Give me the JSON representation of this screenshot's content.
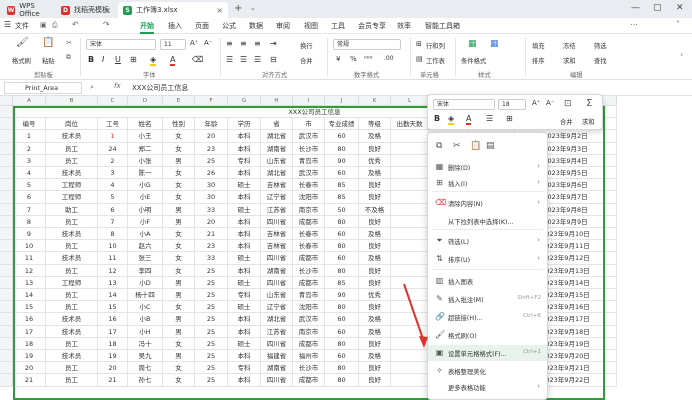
{
  "titlebar": {
    "tabs": [
      {
        "label": "WPS Office",
        "icon": "wps-logo-icon",
        "color": "#e0322b"
      },
      {
        "label": "找稻壳模板",
        "icon": "docer-icon",
        "color": "#e0322b"
      },
      {
        "label": "工作簿3.xlsx",
        "icon": "spreadsheet-icon",
        "color": "#1f9e55"
      }
    ],
    "new_tab": "+"
  },
  "menubar": {
    "items": [
      "文件",
      "开始",
      "插入",
      "页面",
      "公式",
      "数据",
      "审阅",
      "视图",
      "工具",
      "会员专享",
      "效率",
      "智能工具箱"
    ],
    "active": "开始"
  },
  "ribbon": {
    "format_painter": "格式刷",
    "paste": "粘贴",
    "font_name": "宋体",
    "font_size": "11",
    "number_format": "常规",
    "wrap_text": "换行",
    "merge": "合并",
    "row_col": "行和列",
    "worksheet": "工作表",
    "conditional_format": "条件格式",
    "fill": "填充",
    "sort": "排序",
    "freeze": "冻结",
    "sum": "求和",
    "filter": "筛选",
    "find": "查找",
    "groups": [
      "剪贴板",
      "字体",
      "对齐方式",
      "数字格式",
      "单元格",
      "样式",
      "编辑"
    ]
  },
  "formulabar": {
    "name_box": "Print_Area",
    "fx": "fx",
    "content": "XXX公司员工信息"
  },
  "sheet": {
    "columns": [
      "A",
      "B",
      "C",
      "D",
      "E",
      "F",
      "G",
      "H",
      "I",
      "J",
      "K",
      "L",
      "M",
      "N",
      "O"
    ],
    "title": "XXX公司员工信息",
    "headers": [
      "编号",
      "岗位",
      "工号",
      "姓名",
      "性别",
      "年龄",
      "学历",
      "省",
      "市",
      "专业成绩",
      "等级",
      "出勤天数"
    ],
    "rows": [
      [
        "1",
        "技术员",
        "1",
        "小王",
        "女",
        "20",
        "本科",
        "湖北省",
        "武汉市",
        "60",
        "及格"
      ],
      [
        "2",
        "员工",
        "24",
        "郑二",
        "女",
        "23",
        "本科",
        "湖南省",
        "长沙市",
        "80",
        "良好"
      ],
      [
        "3",
        "员工",
        "2",
        "小张",
        "男",
        "25",
        "专科",
        "山东省",
        "青岛市",
        "90",
        "优秀"
      ],
      [
        "4",
        "技术员",
        "3",
        "陈一",
        "女",
        "26",
        "本科",
        "湖北省",
        "武汉市",
        "60",
        "及格"
      ],
      [
        "5",
        "工程师",
        "4",
        "小G",
        "女",
        "30",
        "硕士",
        "吉林省",
        "长春市",
        "85",
        "良好"
      ],
      [
        "6",
        "工程师",
        "5",
        "小E",
        "女",
        "30",
        "本科",
        "辽宁省",
        "沈阳市",
        "85",
        "良好"
      ],
      [
        "7",
        "助工",
        "6",
        "小明",
        "男",
        "33",
        "硕士",
        "江苏省",
        "南京市",
        "50",
        "不及格"
      ],
      [
        "8",
        "员工",
        "7",
        "小F",
        "男",
        "20",
        "本科",
        "四川省",
        "成都市",
        "80",
        "良好"
      ],
      [
        "9",
        "技术员",
        "8",
        "小A",
        "女",
        "21",
        "本科",
        "吉林省",
        "长春市",
        "60",
        "及格"
      ],
      [
        "10",
        "员工",
        "10",
        "赵六",
        "女",
        "23",
        "本科",
        "吉林省",
        "长春市",
        "80",
        "良好"
      ],
      [
        "11",
        "技术员",
        "11",
        "张三",
        "女",
        "33",
        "硕士",
        "四川省",
        "成都市",
        "60",
        "及格"
      ],
      [
        "12",
        "员工",
        "12",
        "李四",
        "女",
        "25",
        "本科",
        "湖南省",
        "长沙市",
        "80",
        "良好"
      ],
      [
        "13",
        "工程师",
        "13",
        "小D",
        "男",
        "25",
        "硕士",
        "四川省",
        "成都市",
        "85",
        "良好"
      ],
      [
        "14",
        "员工",
        "14",
        "杨十四",
        "男",
        "25",
        "专科",
        "山东省",
        "青岛市",
        "90",
        "优秀"
      ],
      [
        "15",
        "员工",
        "15",
        "小C",
        "女",
        "25",
        "硕士",
        "辽宁省",
        "沈阳市",
        "80",
        "良好"
      ],
      [
        "16",
        "技术员",
        "16",
        "小B",
        "男",
        "25",
        "本科",
        "湖北省",
        "武汉市",
        "60",
        "及格"
      ],
      [
        "17",
        "技术员",
        "17",
        "小H",
        "男",
        "25",
        "本科",
        "江苏省",
        "南京市",
        "60",
        "及格"
      ],
      [
        "18",
        "员工",
        "18",
        "冯十",
        "女",
        "25",
        "硕士",
        "四川省",
        "成都市",
        "80",
        "良好"
      ],
      [
        "19",
        "技术员",
        "19",
        "吴九",
        "男",
        "25",
        "本科",
        "福建省",
        "福州市",
        "60",
        "及格"
      ],
      [
        "20",
        "员工",
        "20",
        "周七",
        "女",
        "25",
        "专科",
        "湖南省",
        "长沙市",
        "80",
        "良好"
      ],
      [
        "21",
        "员工",
        "21",
        "孙七",
        "女",
        "25",
        "本科",
        "四川省",
        "成都市",
        "80",
        "良好"
      ]
    ],
    "partial_values": [
      "2023年9月2日",
      "2023年9月3日",
      "2023年9月4日",
      "2023年9月5日",
      "2023年9月6日",
      "2023年9月7日",
      "2023年9月8日",
      "2023年9月9日",
      "2023年9月10日",
      "2023年9月11日",
      "2023年9月12日",
      "2023年9月13日",
      "2023年9月14日",
      "2023年9月15日",
      "2023年9月16日",
      "2023年9月17日",
      "2023年9月18日",
      "2023年9月19日",
      "2023年9月20日",
      "2023年9月21日",
      "2023年9月22日"
    ],
    "highlight_color": "#2e9e3a"
  },
  "minibar": {
    "font_name": "宋体",
    "font_size": "18",
    "merge": "合并",
    "sum": "求和"
  },
  "context_menu": {
    "items": [
      {
        "label": "删除(D)",
        "icon": "delete-icon",
        "submenu": true
      },
      {
        "label": "插入(I)",
        "icon": "insert-icon",
        "submenu": true
      },
      {
        "label": "清除内容(N)",
        "icon": "eraser-icon",
        "submenu": true
      },
      {
        "label": "从下拉列表中选择(K)...",
        "icon": "",
        "submenu": false
      },
      {
        "label": "筛选(L)",
        "icon": "filter-icon",
        "submenu": true
      },
      {
        "label": "排序(U)",
        "icon": "sort-icon",
        "submenu": true
      },
      {
        "label": "插入图表",
        "icon": "chart-icon",
        "submenu": false
      },
      {
        "label": "插入批注(M)",
        "icon": "comment-icon",
        "shortcut": "Shift+F2"
      },
      {
        "label": "超链接(H)...",
        "icon": "link-icon",
        "shortcut": "Ctrl+K"
      },
      {
        "label": "格式刷(O)",
        "icon": "brush-icon",
        "submenu": false
      },
      {
        "label": "设置单元格格式(F)...",
        "icon": "format-cells-icon",
        "shortcut": "Ctrl+1"
      },
      {
        "label": "表格整理美化",
        "icon": "beautify-icon",
        "submenu": false
      },
      {
        "label": "更多表格功能",
        "icon": "",
        "submenu": true
      }
    ]
  }
}
